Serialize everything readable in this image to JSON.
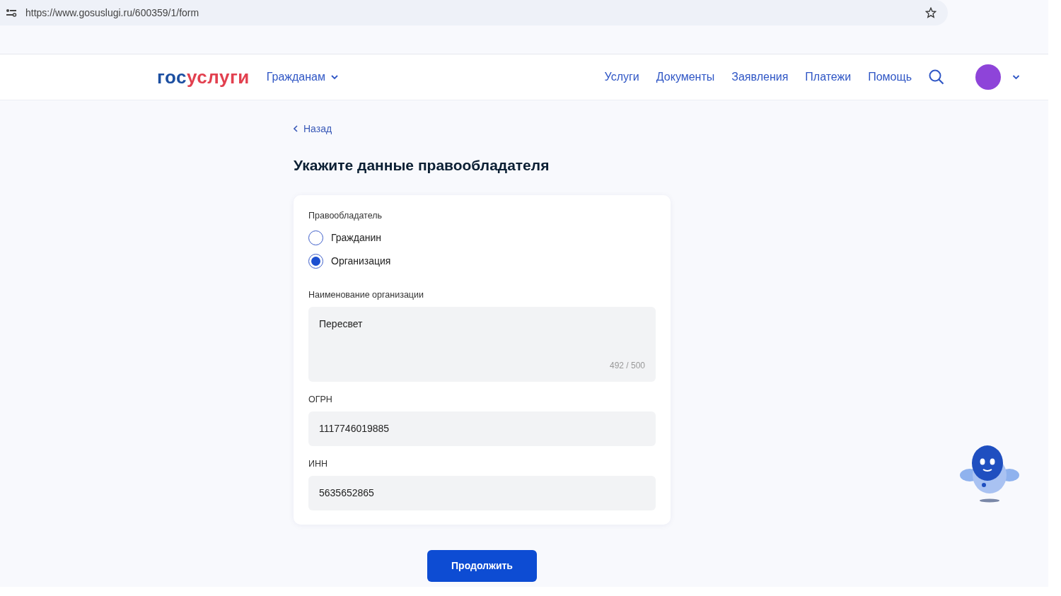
{
  "browser": {
    "url": "https://www.gosuslugi.ru/600359/1/form"
  },
  "header": {
    "logo": {
      "part_1": "гос",
      "part_2": "услуги"
    },
    "audience_menu": "Гражданам",
    "nav": [
      "Услуги",
      "Документы",
      "Заявления",
      "Платежи",
      "Помощь"
    ]
  },
  "back_link": "Назад",
  "title": "Укажите данные правообладателя",
  "form": {
    "owner_label": "Правообладатель",
    "owner_options": [
      {
        "label": "Гражданин",
        "selected": false
      },
      {
        "label": "Организация",
        "selected": true
      }
    ],
    "fields": [
      {
        "kind": "textarea",
        "label": "Наименование организации",
        "value": "Пересвет",
        "counter": "492 / 500"
      },
      {
        "kind": "input",
        "label": "ОГРН",
        "value": "1117746019885"
      },
      {
        "kind": "input",
        "label": "ИНН",
        "value": "5635652865"
      }
    ]
  },
  "continue_button": "Продолжить"
}
